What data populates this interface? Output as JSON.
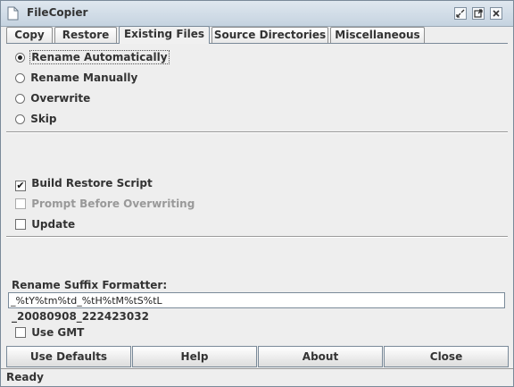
{
  "window": {
    "title": "FileCopier"
  },
  "tabs": [
    {
      "label": "Copy",
      "selected": false
    },
    {
      "label": "Restore",
      "selected": false
    },
    {
      "label": "Existing Files",
      "selected": true
    },
    {
      "label": "Source Directories",
      "selected": false
    },
    {
      "label": "Miscellaneous",
      "selected": false
    }
  ],
  "existing_files": {
    "options": [
      {
        "label": "Rename Automatically",
        "selected": true
      },
      {
        "label": "Rename Manually",
        "selected": false
      },
      {
        "label": "Overwrite",
        "selected": false
      },
      {
        "label": "Skip",
        "selected": false
      }
    ],
    "build_restore_script": {
      "label": "Build Restore Script",
      "checked": true
    },
    "prompt_before_overwriting": {
      "label": "Prompt Before Overwriting",
      "checked": false,
      "enabled": false
    },
    "update": {
      "label": "Update",
      "checked": false
    },
    "suffix_label": "Rename Suffix Formatter:",
    "suffix_value": "_%tY%tm%td_%tH%tM%tS%tL",
    "suffix_preview": "_20080908_222423032",
    "use_gmt": {
      "label": "Use GMT",
      "checked": false
    }
  },
  "buttons": {
    "defaults": "Use Defaults",
    "help": "Help",
    "about": "About",
    "close": "Close"
  },
  "status": "Ready"
}
